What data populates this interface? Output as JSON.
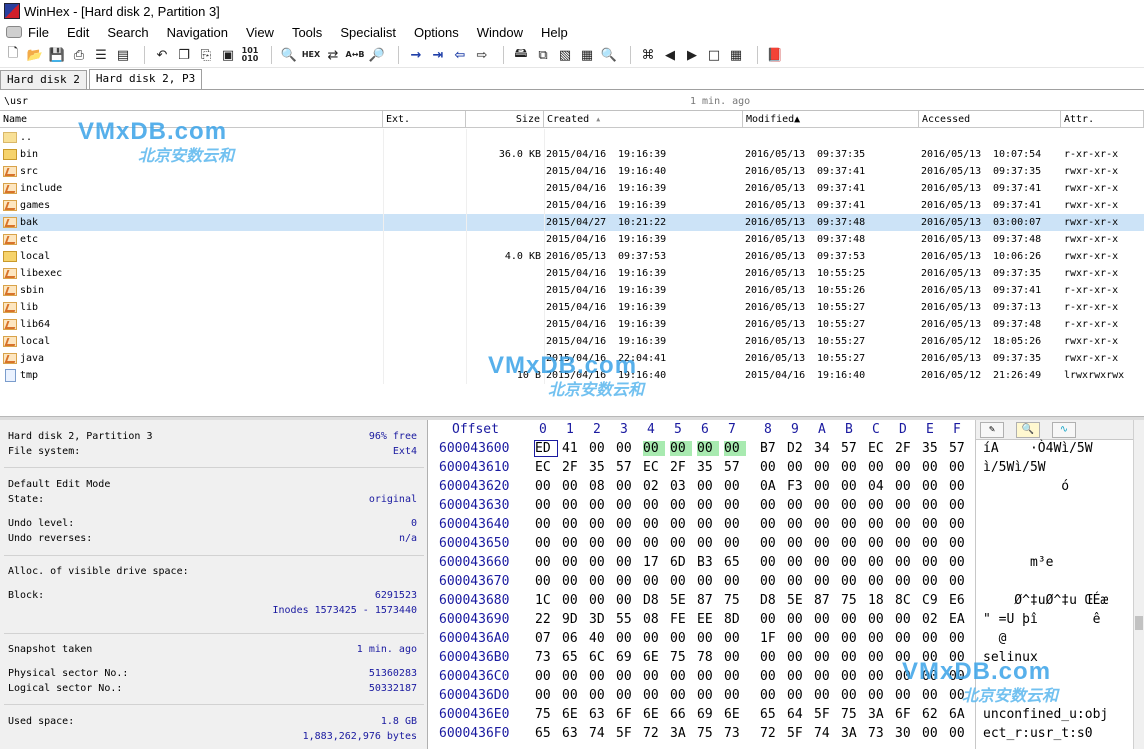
{
  "window": {
    "title": "WinHex - [Hard disk 2, Partition 3]"
  },
  "menu": [
    "File",
    "Edit",
    "Search",
    "Navigation",
    "View",
    "Tools",
    "Specialist",
    "Options",
    "Window",
    "Help"
  ],
  "toolbar": {
    "groups": [
      [
        "new-file-icon",
        "open-folder-icon",
        "save-icon",
        "print-icon",
        "properties-icon",
        "open-disk-icon"
      ],
      [
        "undo-icon",
        "copy-icon",
        "paste-icon",
        "clipboard-icon",
        "binary-icon"
      ],
      [
        "find-icon",
        "find-hex-icon",
        "replace-icon",
        "replace-hex-icon",
        "find-next-icon"
      ],
      [
        "goto-offset-icon",
        "goto-sector-icon",
        "back-icon",
        "forward-icon"
      ],
      [
        "disk-tools-icon",
        "copy-sectors-icon",
        "scan-icon",
        "calculator-icon",
        "search-icon"
      ],
      [
        "hash-icon",
        "prev-sector-icon",
        "next-sector-icon",
        "snapshot-icon",
        "grid-icon"
      ],
      [
        "book-icon"
      ]
    ],
    "binary_label": "101\n010",
    "hex_label": "HEX"
  },
  "tabs": [
    "Hard disk 2",
    "Hard disk 2, P3"
  ],
  "path": {
    "value": "\\usr",
    "age": "1 min. ago"
  },
  "columns": {
    "name": "Name",
    "ext": "Ext.",
    "size": "Size",
    "created": "Created",
    "modified": "Modified",
    "accessed": "Accessed",
    "attr": "Attr."
  },
  "files": [
    {
      "icon": "up",
      "name": "..",
      "size": "",
      "created_date": "",
      "created_time": "",
      "modified_date": "",
      "modified_time": "",
      "accessed_date": "",
      "accessed_time": "",
      "attr": ""
    },
    {
      "icon": "folder",
      "name": "bin",
      "size": "36.0 KB",
      "created_date": "2015/04/16",
      "created_time": "19:16:39",
      "modified_date": "2016/05/13",
      "modified_time": "09:37:35",
      "accessed_date": "2016/05/13",
      "accessed_time": "10:07:54",
      "attr": "r-xr-xr-x"
    },
    {
      "icon": "link",
      "name": "src",
      "size": "",
      "created_date": "2015/04/16",
      "created_time": "19:16:40",
      "modified_date": "2016/05/13",
      "modified_time": "09:37:41",
      "accessed_date": "2016/05/13",
      "accessed_time": "09:37:35",
      "attr": "rwxr-xr-x"
    },
    {
      "icon": "link",
      "name": "include",
      "size": "",
      "created_date": "2015/04/16",
      "created_time": "19:16:39",
      "modified_date": "2016/05/13",
      "modified_time": "09:37:41",
      "accessed_date": "2016/05/13",
      "accessed_time": "09:37:41",
      "attr": "rwxr-xr-x"
    },
    {
      "icon": "link",
      "name": "games",
      "size": "",
      "created_date": "2015/04/16",
      "created_time": "19:16:39",
      "modified_date": "2016/05/13",
      "modified_time": "09:37:41",
      "accessed_date": "2016/05/13",
      "accessed_time": "09:37:41",
      "attr": "rwxr-xr-x"
    },
    {
      "icon": "link",
      "name": "bak",
      "size": "",
      "created_date": "2015/04/27",
      "created_time": "10:21:22",
      "modified_date": "2016/05/13",
      "modified_time": "09:37:48",
      "accessed_date": "2016/05/13",
      "accessed_time": "03:00:07",
      "attr": "rwxr-xr-x",
      "selected": true
    },
    {
      "icon": "link",
      "name": "etc",
      "size": "",
      "created_date": "2015/04/16",
      "created_time": "19:16:39",
      "modified_date": "2016/05/13",
      "modified_time": "09:37:48",
      "accessed_date": "2016/05/13",
      "accessed_time": "09:37:48",
      "attr": "rwxr-xr-x"
    },
    {
      "icon": "folder",
      "name": "local",
      "size": "4.0 KB",
      "created_date": "2016/05/13",
      "created_time": "09:37:53",
      "modified_date": "2016/05/13",
      "modified_time": "09:37:53",
      "accessed_date": "2016/05/13",
      "accessed_time": "10:06:26",
      "attr": "rwxr-xr-x"
    },
    {
      "icon": "link",
      "name": "libexec",
      "size": "",
      "created_date": "2015/04/16",
      "created_time": "19:16:39",
      "modified_date": "2016/05/13",
      "modified_time": "10:55:25",
      "accessed_date": "2016/05/13",
      "accessed_time": "09:37:35",
      "attr": "rwxr-xr-x"
    },
    {
      "icon": "link",
      "name": "sbin",
      "size": "",
      "created_date": "2015/04/16",
      "created_time": "19:16:39",
      "modified_date": "2016/05/13",
      "modified_time": "10:55:26",
      "accessed_date": "2016/05/13",
      "accessed_time": "09:37:41",
      "attr": "r-xr-xr-x"
    },
    {
      "icon": "link",
      "name": "lib",
      "size": "",
      "created_date": "2015/04/16",
      "created_time": "19:16:39",
      "modified_date": "2016/05/13",
      "modified_time": "10:55:27",
      "accessed_date": "2016/05/13",
      "accessed_time": "09:37:13",
      "attr": "r-xr-xr-x"
    },
    {
      "icon": "link",
      "name": "lib64",
      "size": "",
      "created_date": "2015/04/16",
      "created_time": "19:16:39",
      "modified_date": "2016/05/13",
      "modified_time": "10:55:27",
      "accessed_date": "2016/05/13",
      "accessed_time": "09:37:48",
      "attr": "r-xr-xr-x"
    },
    {
      "icon": "link",
      "name": "local",
      "size": "",
      "created_date": "2015/04/16",
      "created_time": "19:16:39",
      "modified_date": "2016/05/13",
      "modified_time": "10:55:27",
      "accessed_date": "2016/05/12",
      "accessed_time": "18:05:26",
      "attr": "rwxr-xr-x"
    },
    {
      "icon": "link",
      "name": "java",
      "size": "",
      "created_date": "2015/04/16",
      "created_time": "22:04:41",
      "modified_date": "2016/05/13",
      "modified_time": "10:55:27",
      "accessed_date": "2016/05/13",
      "accessed_time": "09:37:35",
      "attr": "rwxr-xr-x"
    },
    {
      "icon": "file",
      "name": "tmp",
      "size": "10 B",
      "created_date": "2015/04/16",
      "created_time": "19:16:40",
      "modified_date": "2015/04/16",
      "modified_time": "19:16:40",
      "accessed_date": "2016/05/12",
      "accessed_time": "21:26:49",
      "attr": "lrwxrwxrwx"
    }
  ],
  "info": {
    "disk_name": "Hard disk 2, Partition 3",
    "free": "96% free",
    "fs_label": "File system:",
    "fs_value": "Ext4",
    "edit_mode_label": "Default Edit Mode",
    "state_label": "State:",
    "state_value": "original",
    "undo_level_label": "Undo level:",
    "undo_level_value": "0",
    "undo_rev_label": "Undo reverses:",
    "undo_rev_value": "n/a",
    "alloc_label": "Alloc. of visible drive space:",
    "block_label": "Block:",
    "block_value": "6291523",
    "inodes_value": "Inodes 1573425 - 1573440",
    "snapshot_label": "Snapshot taken",
    "snapshot_value": "1 min. ago",
    "phys_label": "Physical sector No.:",
    "phys_value": "51360283",
    "logic_label": "Logical sector No.:",
    "logic_value": "50332187",
    "used_label": "Used space:",
    "used_value": "1.8 GB",
    "used_bytes": "1,883,262,976 bytes"
  },
  "hex": {
    "offset_label": "Offset",
    "columns": [
      "0",
      "1",
      "2",
      "3",
      "4",
      "5",
      "6",
      "7",
      "8",
      "9",
      "A",
      "B",
      "C",
      "D",
      "E",
      "F"
    ],
    "rows": [
      {
        "offset": "600043600",
        "bytes": [
          "ED",
          "41",
          "00",
          "00",
          "00",
          "00",
          "00",
          "00",
          "B7",
          "D2",
          "34",
          "57",
          "EC",
          "2F",
          "35",
          "57"
        ]
      },
      {
        "offset": "600043610",
        "bytes": [
          "EC",
          "2F",
          "35",
          "57",
          "EC",
          "2F",
          "35",
          "57",
          "00",
          "00",
          "00",
          "00",
          "00",
          "00",
          "00",
          "00"
        ]
      },
      {
        "offset": "600043620",
        "bytes": [
          "00",
          "00",
          "08",
          "00",
          "02",
          "03",
          "00",
          "00",
          "0A",
          "F3",
          "00",
          "00",
          "04",
          "00",
          "00",
          "00"
        ]
      },
      {
        "offset": "600043630",
        "bytes": [
          "00",
          "00",
          "00",
          "00",
          "00",
          "00",
          "00",
          "00",
          "00",
          "00",
          "00",
          "00",
          "00",
          "00",
          "00",
          "00"
        ]
      },
      {
        "offset": "600043640",
        "bytes": [
          "00",
          "00",
          "00",
          "00",
          "00",
          "00",
          "00",
          "00",
          "00",
          "00",
          "00",
          "00",
          "00",
          "00",
          "00",
          "00"
        ]
      },
      {
        "offset": "600043650",
        "bytes": [
          "00",
          "00",
          "00",
          "00",
          "00",
          "00",
          "00",
          "00",
          "00",
          "00",
          "00",
          "00",
          "00",
          "00",
          "00",
          "00"
        ]
      },
      {
        "offset": "600043660",
        "bytes": [
          "00",
          "00",
          "00",
          "00",
          "17",
          "6D",
          "B3",
          "65",
          "00",
          "00",
          "00",
          "00",
          "00",
          "00",
          "00",
          "00"
        ]
      },
      {
        "offset": "600043670",
        "bytes": [
          "00",
          "00",
          "00",
          "00",
          "00",
          "00",
          "00",
          "00",
          "00",
          "00",
          "00",
          "00",
          "00",
          "00",
          "00",
          "00"
        ]
      },
      {
        "offset": "600043680",
        "bytes": [
          "1C",
          "00",
          "00",
          "00",
          "D8",
          "5E",
          "87",
          "75",
          "D8",
          "5E",
          "87",
          "75",
          "18",
          "8C",
          "C9",
          "E6"
        ]
      },
      {
        "offset": "600043690",
        "bytes": [
          "22",
          "9D",
          "3D",
          "55",
          "08",
          "FE",
          "EE",
          "8D",
          "00",
          "00",
          "00",
          "00",
          "00",
          "00",
          "02",
          "EA"
        ]
      },
      {
        "offset": "6000436A0",
        "bytes": [
          "07",
          "06",
          "40",
          "00",
          "00",
          "00",
          "00",
          "00",
          "1F",
          "00",
          "00",
          "00",
          "00",
          "00",
          "00",
          "00"
        ]
      },
      {
        "offset": "6000436B0",
        "bytes": [
          "73",
          "65",
          "6C",
          "69",
          "6E",
          "75",
          "78",
          "00",
          "00",
          "00",
          "00",
          "00",
          "00",
          "00",
          "00",
          "00"
        ]
      },
      {
        "offset": "6000436C0",
        "bytes": [
          "00",
          "00",
          "00",
          "00",
          "00",
          "00",
          "00",
          "00",
          "00",
          "00",
          "00",
          "00",
          "00",
          "00",
          "00",
          "00"
        ]
      },
      {
        "offset": "6000436D0",
        "bytes": [
          "00",
          "00",
          "00",
          "00",
          "00",
          "00",
          "00",
          "00",
          "00",
          "00",
          "00",
          "00",
          "00",
          "00",
          "00",
          "00"
        ]
      },
      {
        "offset": "6000436E0",
        "bytes": [
          "75",
          "6E",
          "63",
          "6F",
          "6E",
          "66",
          "69",
          "6E",
          "65",
          "64",
          "5F",
          "75",
          "3A",
          "6F",
          "62",
          "6A"
        ]
      },
      {
        "offset": "6000436F0",
        "bytes": [
          "65",
          "63",
          "74",
          "5F",
          "72",
          "3A",
          "75",
          "73",
          "72",
          "5F",
          "74",
          "3A",
          "73",
          "30",
          "00",
          "00"
        ]
      }
    ],
    "highlight_row": 0,
    "highlight_cols": [
      4,
      5,
      6,
      7
    ],
    "cursor_row": 0,
    "cursor_col": 0
  },
  "text": {
    "tab_icons": [
      "pencil-icon",
      "template-icon",
      "wave-icon"
    ],
    "rows": [
      "íA    ·Ò4Wì/5W",
      "ì/5Wì/5W",
      "          ó",
      "",
      "",
      "",
      "      m³e",
      "",
      "    Ø^‡uØ^‡u ŒÉæ",
      "\" =U þî       ê",
      "  @",
      "selinux",
      "",
      "",
      "unconfined_u:obj",
      "ect_r:usr_t:s0"
    ]
  },
  "watermarks": [
    {
      "big": "VMxDB.com",
      "cn": "北京安数云和"
    },
    {
      "big": "VMxDB.com",
      "cn": "北京安数云和"
    },
    {
      "big": "VMxDB.com",
      "cn": "北京安数云和"
    }
  ]
}
